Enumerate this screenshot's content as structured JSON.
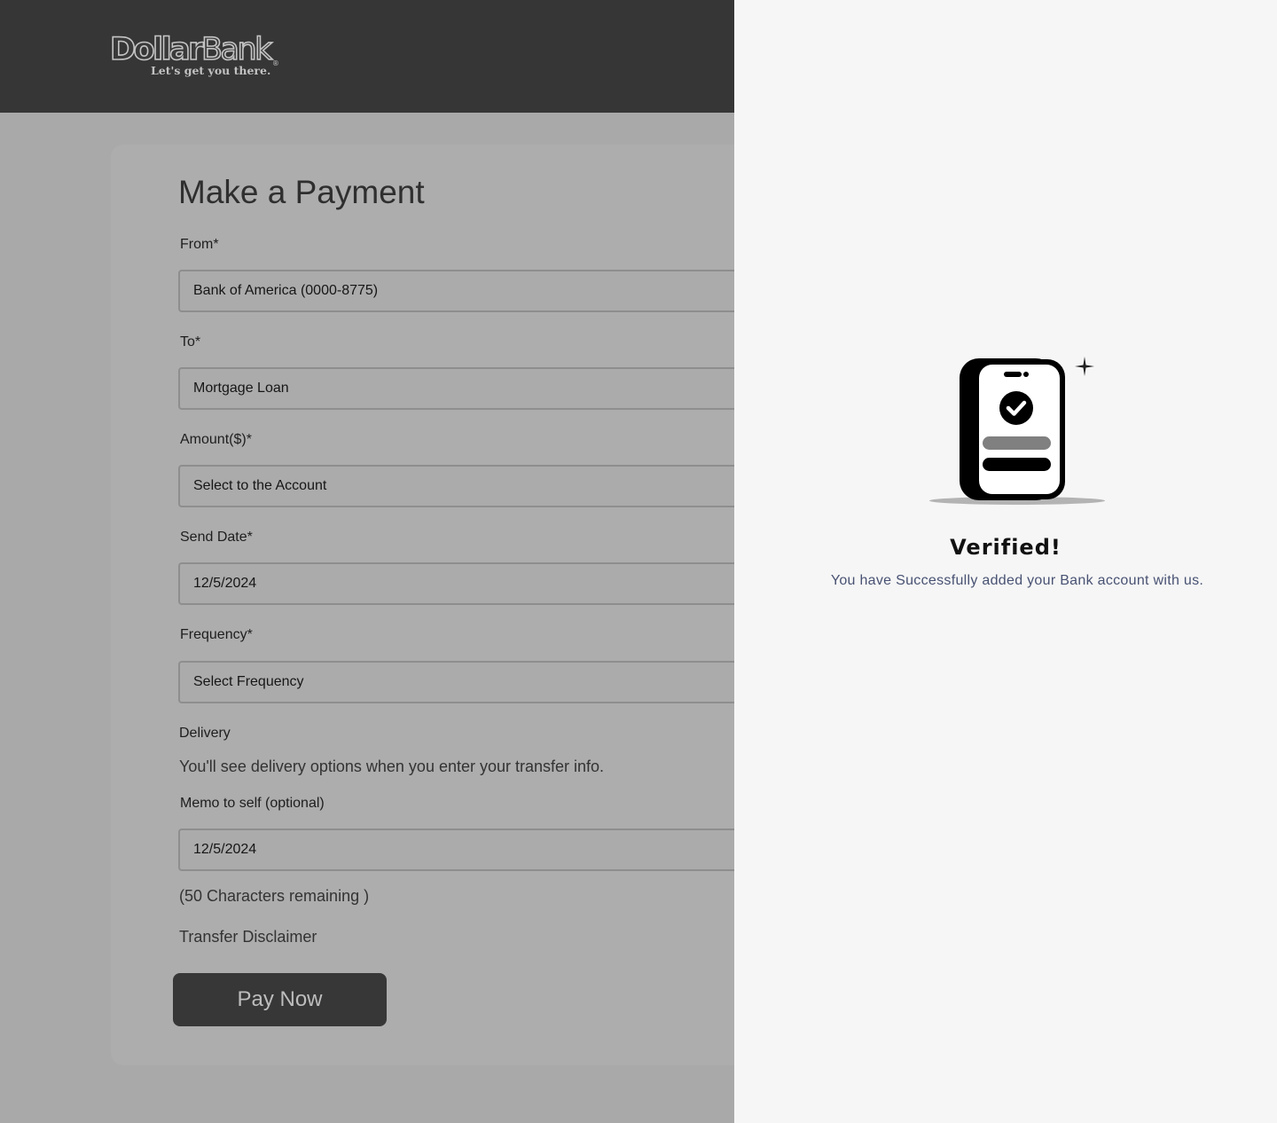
{
  "header": {
    "logo": {
      "word_part1": "Dollar",
      "word_part2": "Bank",
      "registered_mark": "®",
      "tagline": "Let's get you there."
    }
  },
  "payment_form": {
    "title": "Make a Payment",
    "from": {
      "label": "From*",
      "value": "Bank of America (0000-8775)"
    },
    "to": {
      "label": "To*",
      "value": "Mortgage Loan"
    },
    "amount": {
      "label": "Amount($)*",
      "value": "Select to the Account"
    },
    "send_date": {
      "label": "Send Date*",
      "value": "12/5/2024"
    },
    "frequency": {
      "label": "Frequency*",
      "value": "Select Frequency"
    },
    "delivery": {
      "label": "Delivery",
      "text": "You'll see delivery options when you enter your transfer info."
    },
    "memo": {
      "label": "Memo to self (optional)",
      "value": "12/5/2024",
      "remaining": "(50 Characters remaining )"
    },
    "disclaimer_link": "Transfer Disclaimer",
    "pay_button": "Pay Now"
  },
  "verified_panel": {
    "icon": "phone-checkmark-icon",
    "title": "Verified!",
    "message": "You have Successfully added your Bank account with us."
  },
  "colors": {
    "header_bg": "#363636",
    "overlay_bg": "#a9a9a9",
    "panel_bg": "#f6f6f6",
    "message_text": "#485273",
    "button_bg": "#373737"
  }
}
